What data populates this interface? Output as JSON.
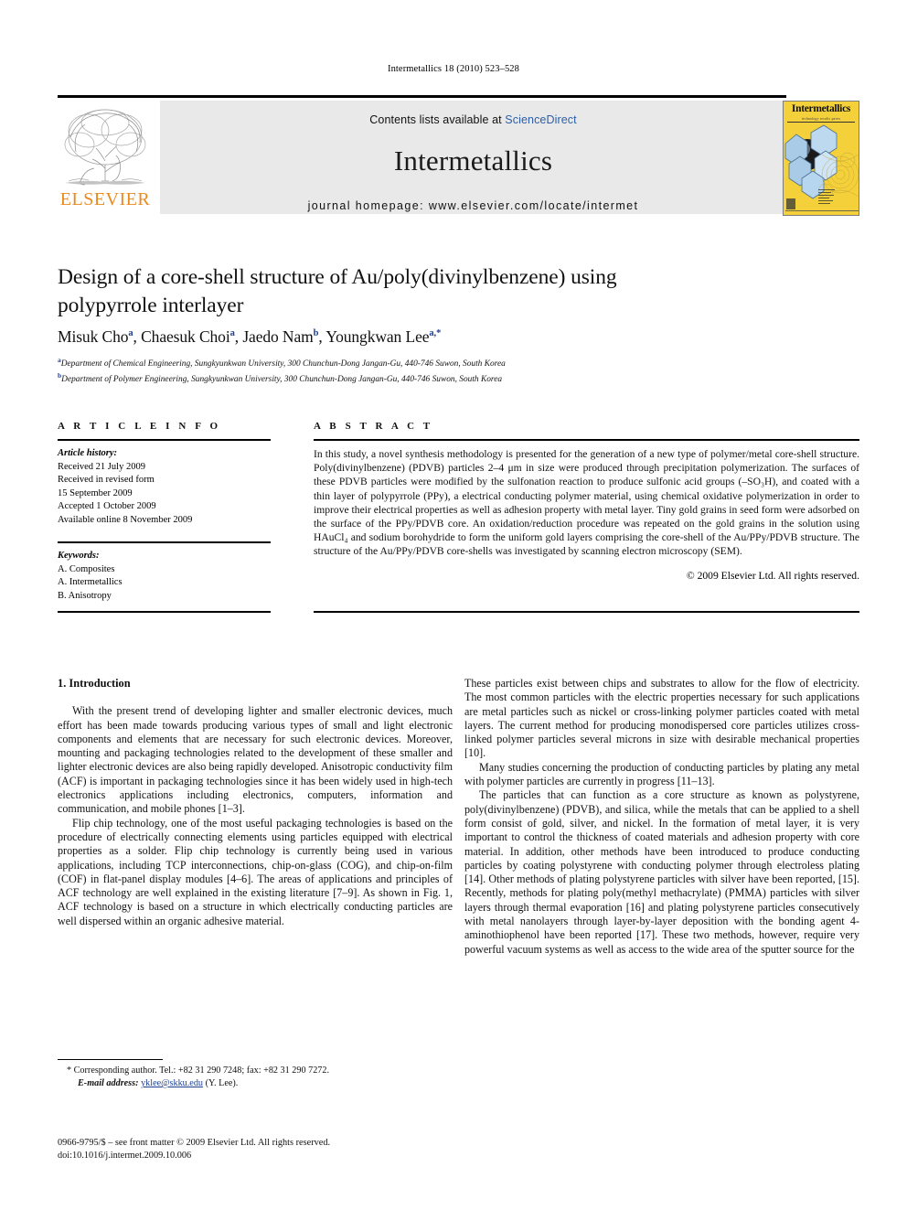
{
  "running_head": "Intermetallics 18 (2010) 523–528",
  "masthead": {
    "publisher_name": "ELSEVIER",
    "contents_prefix": "Contents lists available at ",
    "contents_link": "ScienceDirect",
    "journal_name": "Intermetallics",
    "homepage": "journal homepage: www.elsevier.com/locate/intermet",
    "cover": {
      "title": "Intermetallics",
      "subtitle": "technology results paves"
    }
  },
  "article": {
    "title": "Design of a core-shell structure of Au/poly(divinylbenzene) using polypyrrole interlayer",
    "authors": [
      {
        "name": "Misuk Cho",
        "sup": "a"
      },
      {
        "name": "Chaesuk Choi",
        "sup": "a"
      },
      {
        "name": "Jaedo Nam",
        "sup": "b"
      },
      {
        "name": "Youngkwan Lee",
        "sup": "a,*"
      }
    ],
    "affiliations": [
      {
        "marker": "a",
        "text": "Department of Chemical Engineering, Sungkyunkwan University, 300 Chunchun-Dong Jangan-Gu, 440-746 Suwon, South Korea"
      },
      {
        "marker": "b",
        "text": "Department of Polymer Engineering, Sungkyunkwan University, 300 Chunchun-Dong Jangan-Gu, 440-746 Suwon, South Korea"
      }
    ]
  },
  "article_info": {
    "heading": "A R T I C L E    I N F O",
    "history_label": "Article history:",
    "history": [
      "Received 21 July 2009",
      "Received in revised form",
      "15 September 2009",
      "Accepted 1 October 2009",
      "Available online 8 November 2009"
    ],
    "keywords_label": "Keywords:",
    "keywords": [
      "A. Composites",
      "A. Intermetallics",
      "B. Anisotropy"
    ]
  },
  "abstract": {
    "heading": "A B S T R A C T",
    "text": "In this study, a novel synthesis methodology is presented for the generation of a new type of polymer/metal core-shell structure. Poly(divinylbenzene) (PDVB) particles 2–4 μm in size were produced through precipitation polymerization. The surfaces of these PDVB particles were modified by the sulfonation reaction to produce sulfonic acid groups (–SO₃H), and coated with a thin layer of polypyrrole (PPy), a electrical conducting polymer material, using chemical oxidative polymerization in order to improve their electrical properties as well as adhesion property with metal layer. Tiny gold grains in seed form were adsorbed on the surface of the PPy/PDVB core. An oxidation/reduction procedure was repeated on the gold grains in the solution using HAuCl₄ and sodium borohydride to form the uniform gold layers comprising the core-shell of the Au/PPy/PDVB structure. The structure of the Au/PPy/PDVB core-shells was investigated by scanning electron microscopy (SEM).",
    "copyright": "© 2009 Elsevier Ltd. All rights reserved."
  },
  "body": {
    "section_title": "1.  Introduction",
    "left_paragraphs": [
      "With the present trend of developing lighter and smaller electronic devices, much effort has been made towards producing various types of small and light electronic components and elements that are necessary for such electronic devices. Moreover, mounting and packaging technologies related to the development of these smaller and lighter electronic devices are also being rapidly developed. Anisotropic conductivity film (ACF) is important in packaging technologies since it has been widely used in high-tech electronics applications including electronics, computers, information and communication, and mobile phones [1–3].",
      "Flip chip technology, one of the most useful packaging technologies is based on the procedure of electrically connecting elements using particles equipped with electrical properties as a solder. Flip chip technology is currently being used in various applications, including TCP interconnections, chip-on-glass (COG), and chip-on-film (COF) in flat-panel display modules [4–6]. The areas of applications and principles of ACF technology are well explained in the existing literature [7–9]. As shown in Fig. 1, ACF technology is based on a structure in which electrically conducting particles are well dispersed within an organic adhesive material."
    ],
    "right_paragraphs": [
      "These particles exist between chips and substrates to allow for the flow of electricity. The most common particles with the electric properties necessary for such applications are metal particles such as nickel or cross-linking polymer particles coated with metal layers. The current method for producing monodispersed core particles utilizes cross-linked polymer particles several microns in size with desirable mechanical properties [10].",
      "Many studies concerning the production of conducting particles by plating any metal with polymer particles are currently in progress [11–13].",
      "The particles that can function as a core structure as known as polystyrene, poly(divinylbenzene) (PDVB), and silica, while the metals that can be applied to a shell form consist of gold, silver, and nickel. In the formation of metal layer, it is very important to control the thickness of coated materials and adhesion property with core material. In addition, other methods have been introduced to produce conducting particles by coating polystyrene with conducting polymer through electroless plating [14]. Other methods of plating polystyrene particles with silver have been reported, [15]. Recently, methods for plating poly(methyl methacrylate) (PMMA) particles with silver layers through thermal evaporation [16] and plating polystyrene particles consecutively with metal nanolayers through layer-by-layer deposition with the bonding agent 4-aminothiophenol have been reported [17]. These two methods, however, require very powerful vacuum systems as well as access to the wide area of the sputter source for the"
    ]
  },
  "footnote": {
    "corresponding": "* Corresponding author. Tel.: +82 31 290 7248; fax: +82 31 290 7272.",
    "email_label": "E-mail address:",
    "email": "yklee@skku.edu",
    "email_suffix": "(Y. Lee)."
  },
  "footer": {
    "issn_line": "0966-9795/$ – see front matter © 2009 Elsevier Ltd. All rights reserved.",
    "doi_line": "doi:10.1016/j.intermet.2009.10.006"
  },
  "colors": {
    "link_blue": "#2b5faa",
    "ref_blue": "#1c3f94",
    "elsevier_orange": "#ea8a1e",
    "band_gray": "#e9e9e9",
    "cover_yellow": "#f4d13a"
  }
}
